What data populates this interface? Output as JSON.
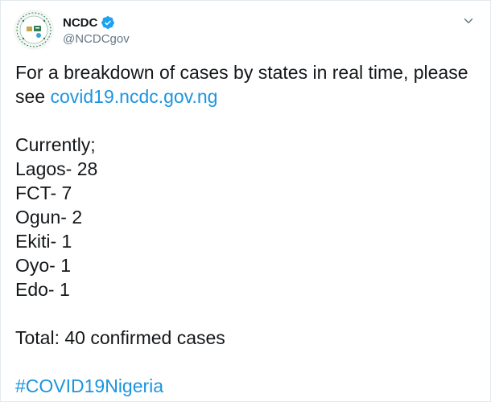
{
  "account": {
    "display_name": "NCDC",
    "handle": "@NCDCgov",
    "verified": true
  },
  "tweet": {
    "intro_line1": "For a breakdown of cases by states in real time, please",
    "intro_line2_prefix": "see ",
    "link_text": "covid19.ncdc.gov.ng",
    "currently_label": "Currently;",
    "states": [
      {
        "text": "Lagos- 28"
      },
      {
        "text": "FCT- 7"
      },
      {
        "text": "Ogun- 2"
      },
      {
        "text": "Ekiti- 1"
      },
      {
        "text": "Oyo- 1"
      },
      {
        "text": "Edo- 1"
      }
    ],
    "total_text": "Total: 40 confirmed cases",
    "hashtag": "#COVID19Nigeria"
  },
  "icons": {
    "verified": "verified-badge-icon",
    "menu": "chevron-down-icon"
  },
  "colors": {
    "link": "#1b95e0",
    "verified": "#1da1f2",
    "secondary_text": "#657786",
    "primary_text": "#14171a"
  }
}
